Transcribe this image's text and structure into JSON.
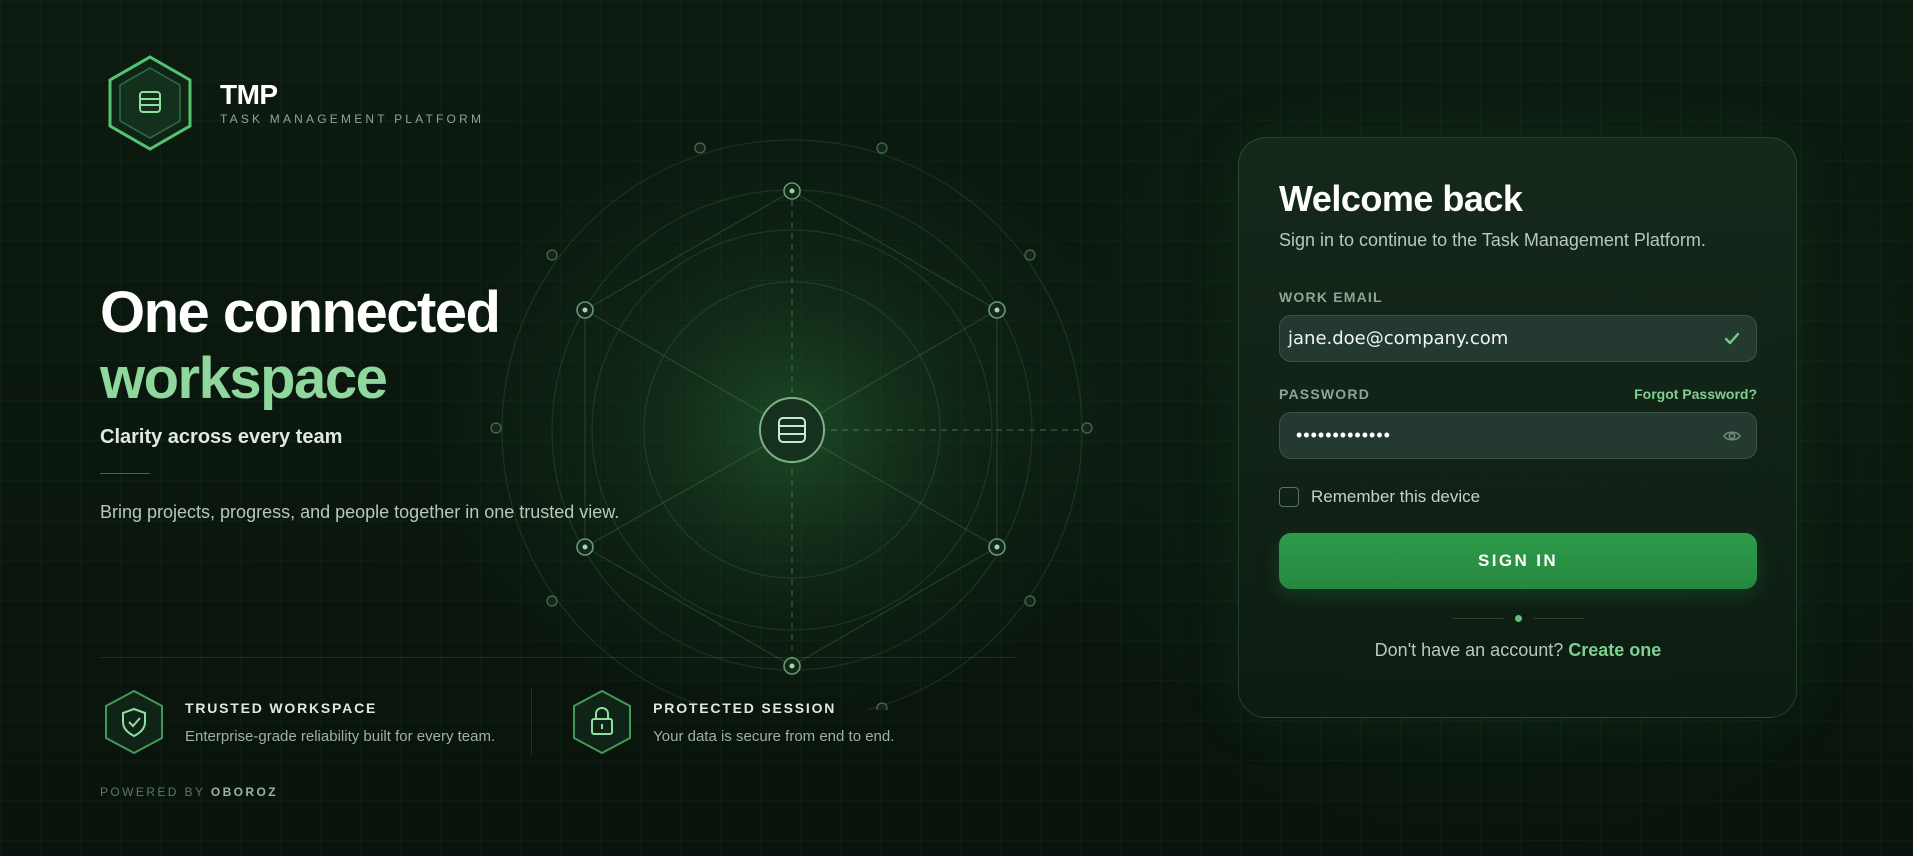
{
  "brand": {
    "title": "TMP",
    "subtitle": "TASK MANAGEMENT PLATFORM",
    "icon": "database-hex-icon"
  },
  "hero": {
    "headline_line1": "One connected",
    "headline_line2": "workspace",
    "tagline": "Clarity across every team",
    "description": "Bring projects, progress, and people together in one trusted view."
  },
  "features": [
    {
      "icon": "shield-check-icon",
      "title": "TRUSTED WORKSPACE",
      "description": "Enterprise-grade reliability built for every team."
    },
    {
      "icon": "lock-icon",
      "title": "PROTECTED SESSION",
      "description": "Your data is secure from end to end."
    }
  ],
  "footer": {
    "powered_prefix": "POWERED BY",
    "powered_name": "OBOROZ"
  },
  "login": {
    "title": "Welcome back",
    "subtitle": "Sign in to continue to the Task Management Platform.",
    "email_label": "WORK EMAIL",
    "email_value": "jane.doe@company.com",
    "password_label": "PASSWORD",
    "forgot_label": "Forgot Password?",
    "password_mask": "•••••••••••••",
    "remember_label": "Remember this device",
    "signin_label": "SIGN IN",
    "signup_prompt": "Don't have an account?",
    "signup_link": "Create one"
  },
  "colors": {
    "accent": "#8fd79c",
    "primary_button": "#2e9b4b",
    "background": "#0a150d"
  }
}
